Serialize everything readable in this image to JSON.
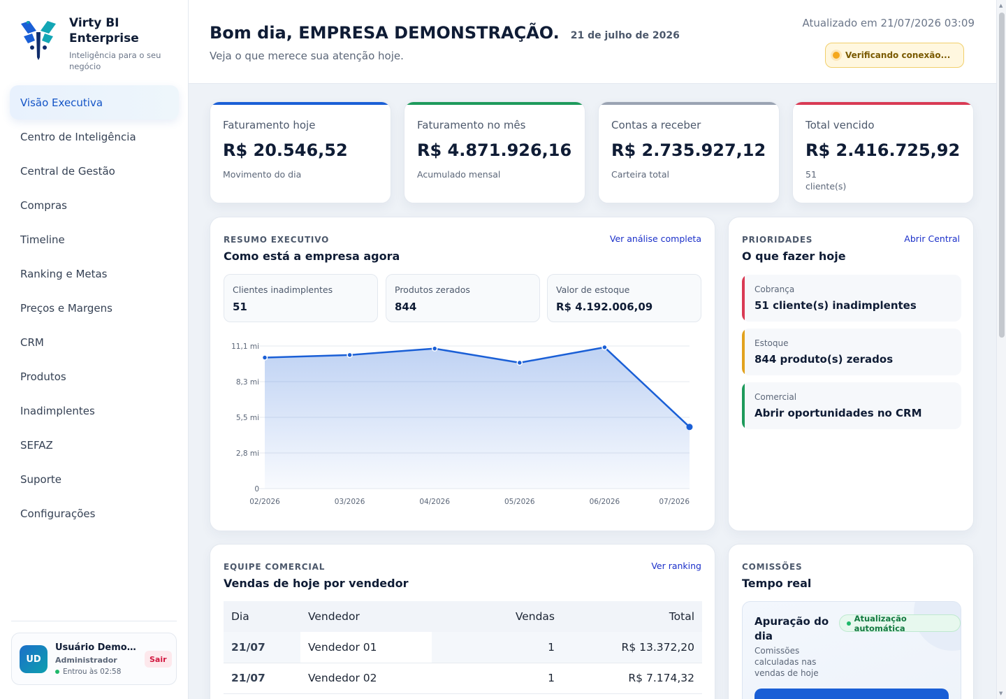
{
  "brand": {
    "title": "Virty BI Enterprise",
    "subtitle": "Inteligência para o seu negócio"
  },
  "nav": {
    "items": [
      {
        "label": "Visão Executiva",
        "active": true
      },
      {
        "label": "Centro de Inteligência"
      },
      {
        "label": "Central de Gestão"
      },
      {
        "label": "Compras"
      },
      {
        "label": "Timeline"
      },
      {
        "label": "Ranking e Metas"
      },
      {
        "label": "Preços e Margens"
      },
      {
        "label": "CRM"
      },
      {
        "label": "Produtos"
      },
      {
        "label": "Inadimplentes"
      },
      {
        "label": "SEFAZ"
      },
      {
        "label": "Suporte"
      },
      {
        "label": "Configurações"
      }
    ]
  },
  "user": {
    "initials": "UD",
    "name": "Usuário Demons...",
    "role": "Administrador",
    "login": "Entrou às 02:58",
    "logout_label": "Sair"
  },
  "header": {
    "greeting": "Bom dia, EMPRESA DEMONSTRAÇÃO.",
    "date": "21 de julho de 2026",
    "subtitle": "Veja o que merece sua atenção hoje.",
    "updated": "Atualizado em 21/07/2026 03:09",
    "connection_status": "Verificando conexão..."
  },
  "kpis": [
    {
      "label": "Faturamento hoje",
      "value": "R$ 20.546,52",
      "note": "Movimento do dia",
      "color": "#1a5fd6"
    },
    {
      "label": "Faturamento no mês",
      "value": "R$ 4.871.926,16",
      "note": "Acumulado mensal",
      "color": "#1d9a5b"
    },
    {
      "label": "Contas a receber",
      "value": "R$ 2.735.927,12",
      "note": "Carteira total",
      "color": "#9aa3b2"
    },
    {
      "label": "Total vencido",
      "value": "R$ 2.416.725,92",
      "note_count": "51",
      "note_unit": "cliente(s)",
      "color": "#d93a54"
    }
  ],
  "summary": {
    "eyebrow": "RESUMO EXECUTIVO",
    "title": "Como está a empresa agora",
    "link": "Ver análise completa",
    "metrics": [
      {
        "label": "Clientes inadimplentes",
        "value": "51"
      },
      {
        "label": "Produtos zerados",
        "value": "844"
      },
      {
        "label": "Valor de estoque",
        "value": "R$ 4.192.006,09"
      }
    ]
  },
  "chart_data": {
    "type": "area",
    "categories": [
      "02/2026",
      "03/2026",
      "04/2026",
      "05/2026",
      "06/2026",
      "07/2026"
    ],
    "values": [
      10.2,
      10.4,
      10.9,
      9.8,
      11.0,
      4.8
    ],
    "y_ticks": [
      "0",
      "2,8 mi",
      "5,5 mi",
      "8,3 mi",
      "11,1 mi"
    ],
    "ylim": [
      0,
      11.1
    ],
    "grid": true,
    "line_color": "#1a5fd6"
  },
  "priorities": {
    "eyebrow": "PRIORIDADES",
    "title": "O que fazer hoje",
    "link": "Abrir Central",
    "items": [
      {
        "category": "Cobrança",
        "text": "51 cliente(s) inadimplentes",
        "color": "#d93a54"
      },
      {
        "category": "Estoque",
        "text": "844 produto(s) zerados",
        "color": "#e2a21e"
      },
      {
        "category": "Comercial",
        "text": "Abrir oportunidades no CRM",
        "color": "#1d9a5b"
      }
    ]
  },
  "sales": {
    "eyebrow": "EQUIPE COMERCIAL",
    "title": "Vendas de hoje por vendedor",
    "link": "Ver ranking",
    "columns": [
      "Dia",
      "Vendedor",
      "Vendas",
      "Total"
    ],
    "rows": [
      {
        "day": "21/07",
        "seller": "Vendedor 01",
        "sales": "1",
        "total": "R$ 13.372,20"
      },
      {
        "day": "21/07",
        "seller": "Vendedor 02",
        "sales": "1",
        "total": "R$ 7.174,32"
      }
    ]
  },
  "commissions": {
    "eyebrow": "COMISSÕES",
    "title": "Tempo real",
    "card_title": "Apuração do dia",
    "card_desc": "Comissões calculadas nas vendas de hoje",
    "badge": "Atualização automática"
  }
}
